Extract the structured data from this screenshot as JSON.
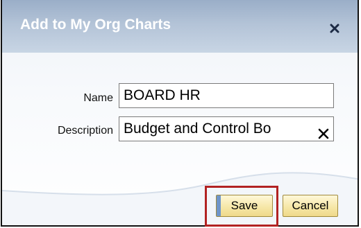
{
  "dialog": {
    "title": "Add to My Org Charts",
    "close_icon": "close-icon"
  },
  "form": {
    "name_label": "Name",
    "name_value": "BOARD HR",
    "description_label": "Description",
    "description_value": "Budget and Control Bo",
    "clear_icon": "clear-x-icon"
  },
  "buttons": {
    "save_label": "Save",
    "cancel_label": "Cancel"
  },
  "colors": {
    "titlebar": "#a9bbd2",
    "button_fill": "#f6e7a8",
    "highlight": "#b22222"
  }
}
